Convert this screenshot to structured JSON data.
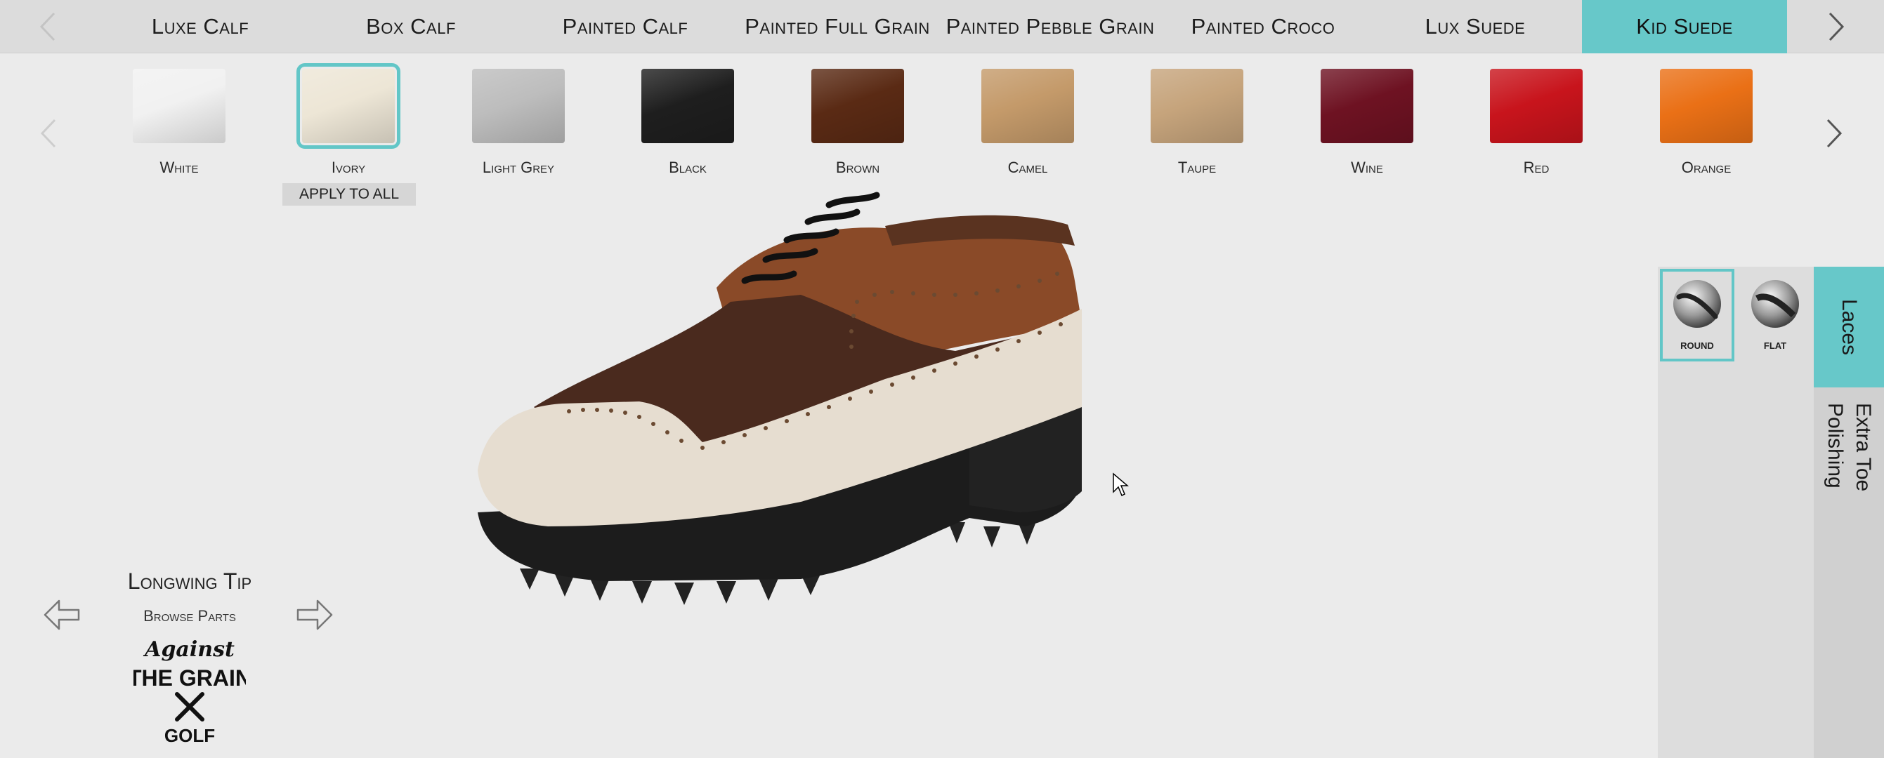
{
  "material_tabs": [
    {
      "label": "Luxe Calf",
      "active": false
    },
    {
      "label": "Box Calf",
      "active": false
    },
    {
      "label": "Painted Calf",
      "active": false
    },
    {
      "label": "Painted Full Grain",
      "active": false
    },
    {
      "label": "Painted Pebble Grain",
      "active": false
    },
    {
      "label": "Painted Croco",
      "active": false
    },
    {
      "label": "Lux Suede",
      "active": false
    },
    {
      "label": "Kid Suede",
      "active": true
    }
  ],
  "swatches": [
    {
      "label": "White",
      "color": "#f1f1f1",
      "selected": false
    },
    {
      "label": "Ivory",
      "color": "#ede6d6",
      "selected": true
    },
    {
      "label": "Light Grey",
      "color": "#bdbdbd",
      "selected": false
    },
    {
      "label": "Black",
      "color": "#1e1e1e",
      "selected": false
    },
    {
      "label": "Brown",
      "color": "#5a2a14",
      "selected": false
    },
    {
      "label": "Camel",
      "color": "#c49a6a",
      "selected": false
    },
    {
      "label": "Taupe",
      "color": "#c6a47c",
      "selected": false
    },
    {
      "label": "Wine",
      "color": "#6e1222",
      "selected": false
    },
    {
      "label": "Red",
      "color": "#c8141c",
      "selected": false
    },
    {
      "label": "Orange",
      "color": "#ea7016",
      "selected": false
    }
  ],
  "apply_all_label": "APPLY TO ALL",
  "style": {
    "name": "Longwing Tip",
    "browse_label": "Browse Parts"
  },
  "logo": {
    "line1": "Against",
    "line2": "THE GRAIN",
    "line3": "GOLF"
  },
  "lace_options": [
    {
      "label": "ROUND",
      "selected": true
    },
    {
      "label": "FLAT",
      "selected": false
    }
  ],
  "side_tabs": {
    "laces": "Laces",
    "extra_line1": "Extra Toe",
    "extra_line2": "Polishing"
  },
  "colors": {
    "accent": "#67c8c9",
    "vamp": "#4a2a1e",
    "quarter": "#8a4a28",
    "wingtip": "#e6ddd0",
    "sole": "#1c1c1c"
  }
}
